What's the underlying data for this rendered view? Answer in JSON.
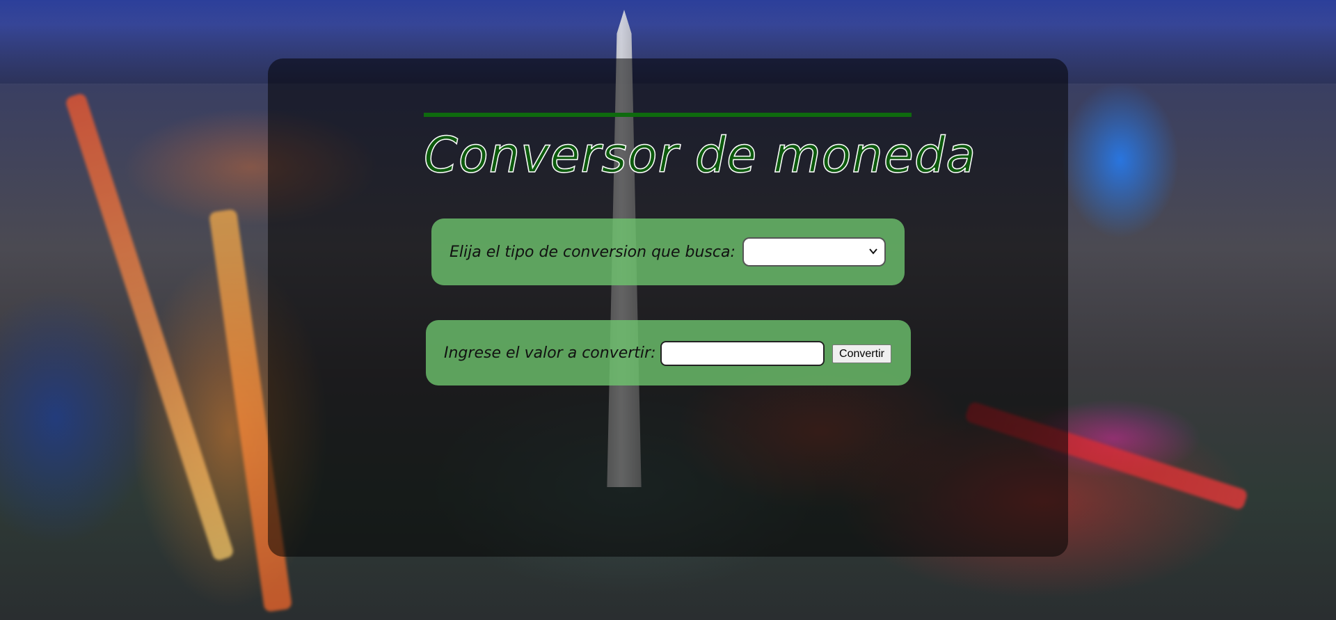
{
  "page": {
    "title": "Conversor de moneda"
  },
  "conversion_type": {
    "label": "Elija el tipo de conversion que busca:",
    "selected": ""
  },
  "value_input": {
    "label": "Ingrese el valor a convertir:",
    "value": ""
  },
  "convert_button": {
    "label": "Convertir"
  },
  "colors": {
    "title_fill": "#0d5a0d",
    "title_rule": "#0e6a0e",
    "card_bg": "#70c870",
    "panel_bg": "#000000"
  },
  "icons": {
    "select_chevron": "chevron-down-icon"
  }
}
